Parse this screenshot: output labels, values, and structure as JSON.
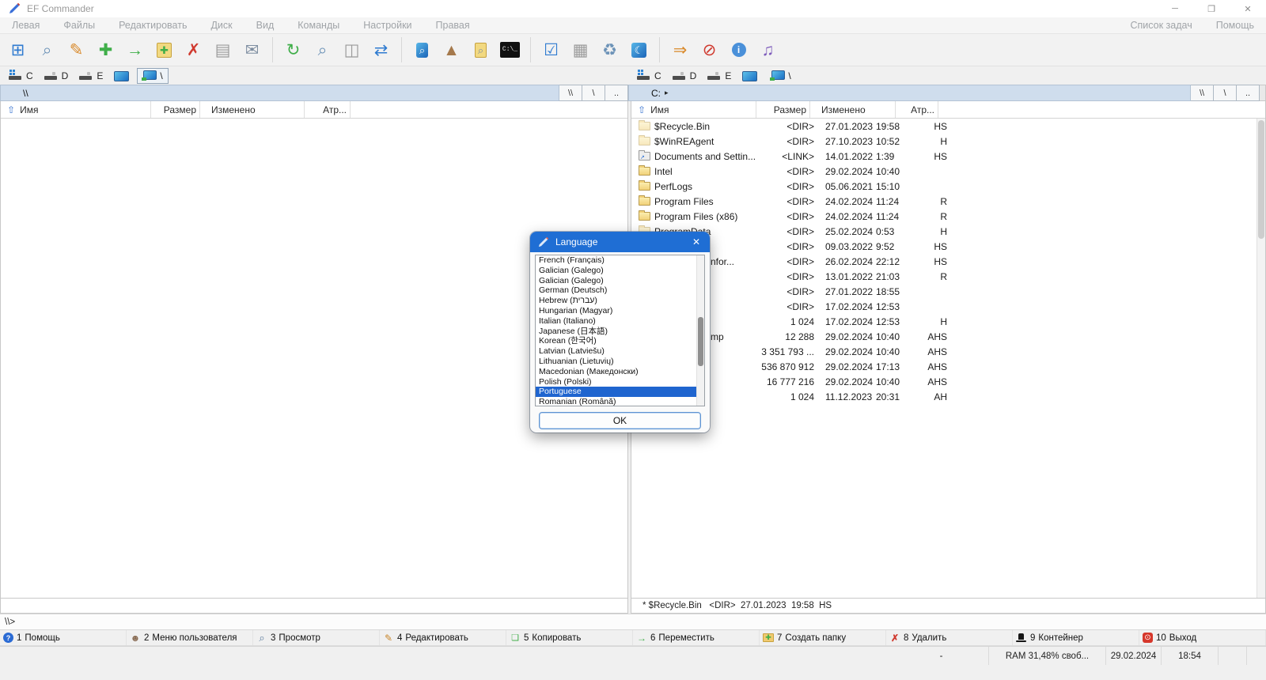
{
  "window": {
    "title": "EF Commander",
    "controls": [
      {
        "glyph": "─",
        "name": "minimize-button"
      },
      {
        "glyph": "❐",
        "name": "maximize-button"
      },
      {
        "glyph": "✕",
        "name": "close-button"
      }
    ]
  },
  "menu": {
    "left": [
      {
        "label": "Левая"
      },
      {
        "label": "Файлы"
      },
      {
        "label": "Редактировать"
      },
      {
        "label": "Диск"
      },
      {
        "label": "Вид"
      },
      {
        "label": "Команды"
      },
      {
        "label": "Настройки"
      },
      {
        "label": "Правая"
      }
    ],
    "right": [
      {
        "label": "Список задач"
      },
      {
        "label": "Помощь"
      }
    ]
  },
  "toolbar": {
    "items": [
      {
        "name": "new-window-icon",
        "glyph": "⊞",
        "cls": "c-blue"
      },
      {
        "name": "view-file-icon",
        "glyph": "⌕",
        "cls": "c-steel"
      },
      {
        "name": "edit-file-icon",
        "glyph": "✎",
        "cls": "c-orange"
      },
      {
        "name": "copy-file-icon",
        "glyph": "✚",
        "cls": "c-green"
      },
      {
        "name": "move-file-icon",
        "glyph": "→",
        "cls": "c-green"
      },
      {
        "name": "new-folder-icon",
        "glyph": "✚",
        "cls": "bg-folder c-green"
      },
      {
        "name": "delete-icon",
        "glyph": "✗",
        "cls": "c-red"
      },
      {
        "name": "print-icon",
        "glyph": "▤",
        "cls": "c-grey"
      },
      {
        "name": "email-icon",
        "glyph": "✉",
        "cls": "c-slate"
      },
      {
        "name": "toolbar-separator",
        "glyph": "",
        "cls": "tb-sep"
      },
      {
        "name": "refresh-icon",
        "glyph": "↻",
        "cls": "c-green"
      },
      {
        "name": "search-icon",
        "glyph": "⌕",
        "cls": "c-steel"
      },
      {
        "name": "split-files-icon",
        "glyph": "◫",
        "cls": "c-grey"
      },
      {
        "name": "sync-icon",
        "glyph": "⇄",
        "cls": "c-blue"
      },
      {
        "name": "toolbar-separator",
        "glyph": "",
        "cls": "tb-sep"
      },
      {
        "name": "zoom-screen-icon",
        "glyph": "⌕",
        "cls": "bg-screen"
      },
      {
        "name": "pyramid-icon",
        "glyph": "▲",
        "cls": "c-brown"
      },
      {
        "name": "folder-search-icon",
        "glyph": "⌕",
        "cls": "bg-folder c-slate"
      },
      {
        "name": "terminal-icon",
        "glyph": "C:\\_",
        "cls": "bg-term"
      },
      {
        "name": "toolbar-separator",
        "glyph": "",
        "cls": "tb-sep"
      },
      {
        "name": "settings-check-icon",
        "glyph": "☑",
        "cls": "c-blue"
      },
      {
        "name": "print-screen-icon",
        "glyph": "▦",
        "cls": "c-grey"
      },
      {
        "name": "recycle-bin-icon",
        "glyph": "♻",
        "cls": "c-steel"
      },
      {
        "name": "screensaver-icon",
        "glyph": "☾",
        "cls": "bg-screen"
      },
      {
        "name": "toolbar-separator",
        "glyph": "",
        "cls": "tb-sep"
      },
      {
        "name": "ftp-connect-icon",
        "glyph": "⇒",
        "cls": "c-orange"
      },
      {
        "name": "ftp-disconnect-icon",
        "glyph": "⊘",
        "cls": "c-red"
      },
      {
        "name": "disk-info-icon",
        "glyph": "i",
        "cls": "bg-circle"
      },
      {
        "name": "multimedia-icon",
        "glyph": "♫",
        "cls": "c-purple"
      }
    ]
  },
  "drive_bar": {
    "left": [
      {
        "label": "C",
        "cls": "hdd-grid",
        "name": "left-drive-c-button"
      },
      {
        "label": "D",
        "cls": "hdd",
        "name": "left-drive-d-button"
      },
      {
        "label": "E",
        "cls": "hdd",
        "name": "left-drive-e-button"
      },
      {
        "label": "",
        "cls": "screen",
        "name": "left-desktop-button"
      },
      {
        "label": "\\",
        "cls": "net selected",
        "name": "left-network-button"
      }
    ],
    "right": [
      {
        "label": "C",
        "cls": "hdd-grid",
        "name": "right-drive-c-button"
      },
      {
        "label": "D",
        "cls": "hdd",
        "name": "right-drive-d-button"
      },
      {
        "label": "E",
        "cls": "hdd",
        "name": "right-drive-e-button"
      },
      {
        "label": "",
        "cls": "screen",
        "name": "right-desktop-button"
      },
      {
        "label": "\\",
        "cls": "net",
        "name": "right-network-button"
      }
    ]
  },
  "left_panel": {
    "path": "\\\\",
    "path_buttons": [
      {
        "label": "\\\\"
      },
      {
        "label": "\\"
      },
      {
        "label": ".."
      }
    ],
    "headers": {
      "name": "Имя",
      "size": "Размер",
      "modified": "Изменено",
      "attr": "Атр..."
    },
    "sort_arrow": "⇧",
    "status": ""
  },
  "right_panel": {
    "path": "C:",
    "path_caret": "▸",
    "path_buttons": [
      {
        "label": "\\\\"
      },
      {
        "label": "\\"
      },
      {
        "label": ".."
      }
    ],
    "headers": {
      "name": "Имя",
      "size": "Размер",
      "modified": "Изменено",
      "attr": "Атр..."
    },
    "sort_arrow": "⇧",
    "rows": [
      {
        "name": "$Recycle.Bin",
        "size": "<DIR>",
        "date": "27.01.2023",
        "time": "19:58",
        "attr": "HS",
        "cls": "ic-folder-pale"
      },
      {
        "name": "$WinREAgent",
        "size": "<DIR>",
        "date": "27.10.2023",
        "time": "10:52",
        "attr": "H",
        "cls": "ic-folder-pale"
      },
      {
        "name": "Documents and Settin...",
        "size": "<LINK>",
        "date": "14.01.2022",
        "time": "1:39",
        "attr": "HS",
        "cls": "ic-link"
      },
      {
        "name": "Intel",
        "size": "<DIR>",
        "date": "29.02.2024",
        "time": "10:40",
        "attr": "",
        "cls": "ic-folder"
      },
      {
        "name": "PerfLogs",
        "size": "<DIR>",
        "date": "05.06.2021",
        "time": "15:10",
        "attr": "",
        "cls": "ic-folder"
      },
      {
        "name": "Program Files",
        "size": "<DIR>",
        "date": "24.02.2024",
        "time": "11:24",
        "attr": "R",
        "cls": "ic-folder"
      },
      {
        "name": "Program Files (x86)",
        "size": "<DIR>",
        "date": "24.02.2024",
        "time": "11:24",
        "attr": "R",
        "cls": "ic-folder"
      },
      {
        "name": "ProgramData",
        "size": "<DIR>",
        "date": "25.02.2024",
        "time": "0:53",
        "attr": "H",
        "cls": "ic-folder-pale"
      },
      {
        "name": "",
        "size": "<DIR>",
        "date": "09.03.2022",
        "time": "9:52",
        "attr": "HS",
        "cls": "obscured"
      },
      {
        "name": "nfor...",
        "size": "<DIR>",
        "date": "26.02.2024",
        "time": "22:12",
        "attr": "HS",
        "cls": "obscured"
      },
      {
        "name": "",
        "size": "<DIR>",
        "date": "13.01.2022",
        "time": "21:03",
        "attr": "R",
        "cls": "obscured"
      },
      {
        "name": "",
        "size": "<DIR>",
        "date": "27.01.2022",
        "time": "18:55",
        "attr": "",
        "cls": "obscured"
      },
      {
        "name": "",
        "size": "<DIR>",
        "date": "17.02.2024",
        "time": "12:53",
        "attr": "",
        "cls": "obscured"
      },
      {
        "name": "",
        "size": "1 024",
        "date": "17.02.2024",
        "time": "12:53",
        "attr": "H",
        "cls": "obscured"
      },
      {
        "name": "mp",
        "size": "12 288",
        "date": "29.02.2024",
        "time": "10:40",
        "attr": "AHS",
        "cls": "obscured"
      },
      {
        "name": "",
        "size": "3 351 793 ...",
        "date": "29.02.2024",
        "time": "10:40",
        "attr": "AHS",
        "cls": "obscured"
      },
      {
        "name": "",
        "size": "536 870 912",
        "date": "29.02.2024",
        "time": "17:13",
        "attr": "AHS",
        "cls": "obscured"
      },
      {
        "name": "",
        "size": "16 777 216",
        "date": "29.02.2024",
        "time": "10:40",
        "attr": "AHS",
        "cls": "obscured"
      },
      {
        "name": "",
        "size": "1 024",
        "date": "11.12.2023",
        "time": "20:31",
        "attr": "AH",
        "cls": "obscured"
      }
    ],
    "status": "* $Recycle.Bin   <DIR>  27.01.2023  19:58  HS"
  },
  "command_line": {
    "prompt": "\\\\>"
  },
  "function_bar": [
    {
      "key": "1",
      "label": "Помощь",
      "glyph": "?",
      "cls": "fk-help",
      "icon": "help-icon"
    },
    {
      "key": "2",
      "label": "Меню пользователя",
      "glyph": "☻",
      "cls": "fk-user",
      "icon": "user-menu-icon"
    },
    {
      "key": "3",
      "label": "Просмотр",
      "glyph": "⌕",
      "cls": "fk-view",
      "icon": "view-icon"
    },
    {
      "key": "4",
      "label": "Редактировать",
      "glyph": "✎",
      "cls": "fk-edit",
      "icon": "edit-icon"
    },
    {
      "key": "5",
      "label": "Копировать",
      "glyph": "❏",
      "cls": "fk-copy",
      "icon": "copy-icon"
    },
    {
      "key": "6",
      "label": "Переместить",
      "glyph": "→",
      "cls": "fk-move",
      "icon": "move-icon"
    },
    {
      "key": "7",
      "label": "Создать папку",
      "glyph": "✚",
      "cls": "fk-mkdir",
      "icon": "new-folder-icon"
    },
    {
      "key": "8",
      "label": "Удалить",
      "glyph": "✗",
      "cls": "fk-del",
      "icon": "delete-icon"
    },
    {
      "key": "9",
      "label": "Контейнер",
      "glyph": "",
      "cls": "fk-hat",
      "icon": "container-icon"
    },
    {
      "key": "10",
      "label": "Выход",
      "glyph": "⊙",
      "cls": "fk-exit",
      "icon": "exit-icon"
    }
  ],
  "status_bar": {
    "cells": [
      {
        "label": "",
        "cls": "sb-fill",
        "name": "statusbar-spacer"
      },
      {
        "label": "-",
        "cls": "sb-dash",
        "name": "statusbar-dash"
      },
      {
        "label": "RAM 31,48% своб...",
        "cls": "sb-ram",
        "name": "statusbar-ram"
      },
      {
        "label": "29.02.2024",
        "cls": "sb-date",
        "name": "statusbar-date"
      },
      {
        "label": "18:54",
        "cls": "sb-time",
        "name": "statusbar-time"
      },
      {
        "label": "",
        "cls": "sb-s1",
        "name": "statusbar-cell-empty"
      },
      {
        "label": "",
        "cls": "sb-s2",
        "name": "statusbar-cell-empty"
      }
    ]
  },
  "dialog": {
    "title": "Language",
    "close_glyph": "✕",
    "items": [
      {
        "label": "French (Français)"
      },
      {
        "label": "Galician (Galego)"
      },
      {
        "label": "Galician (Galego)"
      },
      {
        "label": "German (Deutsch)"
      },
      {
        "label": "Hebrew (עברית)"
      },
      {
        "label": "Hungarian (Magyar)"
      },
      {
        "label": "Italian (Italiano)"
      },
      {
        "label": "Japanese (日本語)"
      },
      {
        "label": "Korean (한국어)"
      },
      {
        "label": "Latvian (Latviešu)"
      },
      {
        "label": "Lithuanian (Lietuvių)"
      },
      {
        "label": "Macedonian (Македонски)"
      },
      {
        "label": "Polish (Polski)"
      },
      {
        "label": "Portuguese",
        "cls": "selected"
      },
      {
        "label": "Romanian (Română)"
      }
    ],
    "ok_label": "OK"
  }
}
